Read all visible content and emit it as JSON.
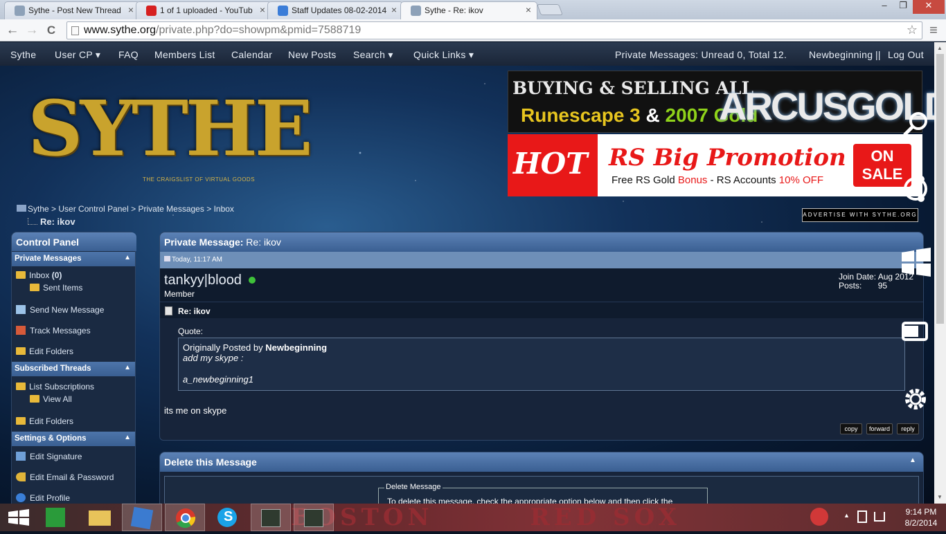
{
  "browser": {
    "tabs": [
      {
        "label": "Sythe - Post New Thread",
        "icon": "shield-icon"
      },
      {
        "label": "1 of 1 uploaded - YouTub",
        "icon": "youtube-icon"
      },
      {
        "label": "Staff Updates 08-02-2014",
        "icon": "checkmark-icon"
      },
      {
        "label": "Sythe - Re: ikov",
        "icon": "shield-icon"
      }
    ],
    "close_glyph": "×",
    "window_min": "–",
    "window_restore": "❐",
    "window_close": "✕",
    "back": "←",
    "forward": "→",
    "reload": "C",
    "url_host": "www.sythe.org",
    "url_path": "/private.php?do=showpm&pmid=7588719",
    "star": "☆",
    "menu": "≡"
  },
  "sitenav": {
    "items": [
      "Sythe",
      "User CP ▾",
      "FAQ",
      "Members List",
      "Calendar",
      "New Posts",
      "Search ▾",
      "Quick Links ▾"
    ],
    "pm_status": "Private Messages: Unread 0, Total 12.",
    "username": "Newbeginning",
    "sep": "||",
    "logout": "Log Out"
  },
  "logo": {
    "text": "SYTHE",
    "tagline": "THE CRAIGSLIST OF VIRTUAL GOODS"
  },
  "ads": {
    "ad1_line1": "BUYING & SELLING ALL",
    "ad1_line2a": "Runescape 3",
    "ad1_line2b": "&",
    "ad1_line2c": "2007 Gold",
    "ad1_brand": "ARCUSGOLD",
    "ad2_hot": "HOT",
    "ad2_title": "RS Big Promotion",
    "ad2_sub1": "Free RS Gold ",
    "ad2_sub2": "Bonus",
    "ad2_sub3": " - RS Accounts ",
    "ad2_sub4": "10% OFF",
    "ad2_badge1": "ON",
    "ad2_badge2": "SALE",
    "advertise": "ADVERTISE WITH SYTHE.ORG"
  },
  "breadcrumb": {
    "path": [
      "Sythe",
      "User Control Panel",
      "Private Messages",
      "Inbox"
    ],
    "sep": ">",
    "title": "Re: ikov"
  },
  "sidebar": {
    "title": "Control Panel",
    "sections": {
      "pm": "Private Messages",
      "subs": "Subscribed Threads",
      "settings": "Settings & Options"
    },
    "items": {
      "inbox": "Inbox",
      "inbox_count": "(0)",
      "sent": "Sent Items",
      "send_new": "Send New Message",
      "track": "Track Messages",
      "edit_folders": "Edit Folders",
      "list_subs": "List Subscriptions",
      "view_all": "View All",
      "edit_folders2": "Edit Folders",
      "edit_sig": "Edit Signature",
      "edit_email": "Edit Email & Password",
      "edit_profile": "Edit Profile"
    },
    "caret": "▲"
  },
  "pm": {
    "header_label": "Private Message:",
    "header_subject": "Re: ikov",
    "date": "Today, 11:17 AM",
    "sender": "tankyy|blood",
    "sender_title": "Member",
    "join_label": "Join Date:",
    "join_value": "Aug 2012",
    "posts_label": "Posts:",
    "posts_value": "95",
    "subject": "Re: ikov",
    "quote_label": "Quote:",
    "quote_by": "Originally Posted by ",
    "quote_author": "Newbeginning",
    "quote_line1": "add my skype :",
    "quote_line2": "a_newbeginning1",
    "body": "its me on skype",
    "buttons": {
      "copy": "copy",
      "forward": "forward",
      "reply": "reply"
    }
  },
  "delete": {
    "title": "Delete this Message",
    "legend": "Delete Message",
    "text": "To delete this message, check the appropriate option below and then click the"
  },
  "taskbar": {
    "bg_text_1": "BOSTON",
    "bg_text_2": "RED SOX",
    "time": "9:14 PM",
    "date": "8/2/2014"
  }
}
